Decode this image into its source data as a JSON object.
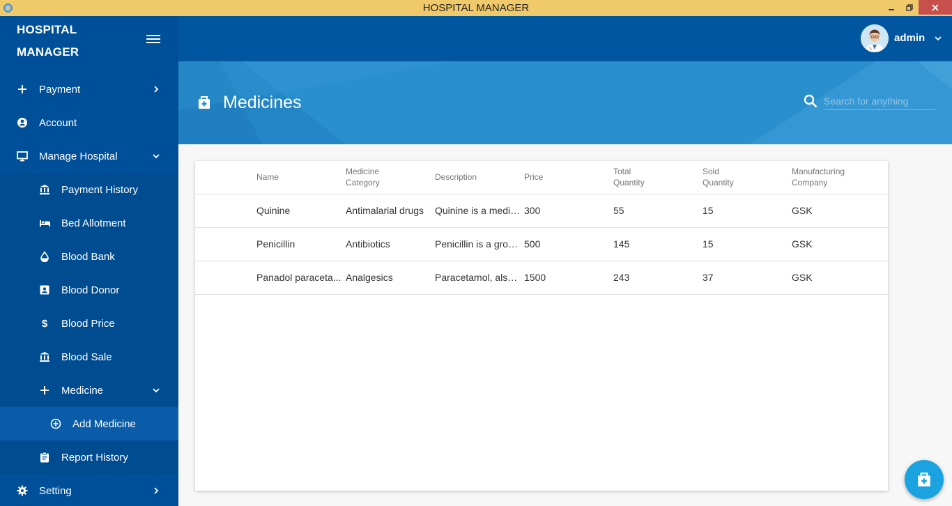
{
  "window": {
    "title": "HOSPITAL MANAGER"
  },
  "brand": {
    "line1": "HOSPITAL",
    "line2": "MANAGER"
  },
  "user": {
    "name": "admin"
  },
  "nav": {
    "payment": "Payment",
    "account": "Account",
    "manage_hospital": "Manage Hospital",
    "payment_history": "Payment History",
    "bed_allotment": "Bed Allotment",
    "blood_bank": "Blood Bank",
    "blood_donor": "Blood Donor",
    "blood_price": "Blood Price",
    "blood_sale": "Blood Sale",
    "medicine": "Medicine",
    "add_medicine": "Add Medicine",
    "report_history": "Report History",
    "setting": "Setting"
  },
  "page": {
    "title": "Medicines"
  },
  "search": {
    "placeholder": "Search for anything"
  },
  "table": {
    "headers": [
      {
        "l1": "Name",
        "l2": ""
      },
      {
        "l1": "Medicine",
        "l2": "Category"
      },
      {
        "l1": "Description",
        "l2": ""
      },
      {
        "l1": "Price",
        "l2": ""
      },
      {
        "l1": "Total",
        "l2": "Quantity"
      },
      {
        "l1": "Sold",
        "l2": "Quantity"
      },
      {
        "l1": "Manufacturing",
        "l2": "Company"
      }
    ],
    "rows": [
      [
        "Quinine",
        "Antimalarial drugs",
        "Quinine is a medic...",
        "300",
        "55",
        "15",
        "GSK"
      ],
      [
        "Penicillin",
        "Antibiotics",
        "Penicillin is a group...",
        "500",
        "145",
        "15",
        "GSK"
      ],
      [
        "Panadol paraceta...",
        "Analgesics",
        "Paracetamol, also ...",
        "1500",
        "243",
        "37",
        "GSK"
      ]
    ]
  },
  "colors": {
    "titlebar": "#f0c96b",
    "sidebar": "#005099",
    "topbar": "#00569f",
    "banner": "#2a8fcd",
    "fab": "#1aa3e0",
    "close": "#c7504c"
  },
  "icons": {
    "app": "gear-app-icon",
    "payment": "plus-icon",
    "account": "account-circle-icon",
    "manage": "monitor-icon",
    "bank": "bank-icon",
    "bed": "bed-icon",
    "drop": "drop-icon",
    "donor": "contact-card-icon",
    "dollar": "dollar-icon",
    "medicine": "plus-icon",
    "add": "plus-circle-icon",
    "report": "clipboard-icon",
    "setting": "gear-icon",
    "page": "medical-bag-icon",
    "search": "search-icon",
    "fab": "medical-bag-icon"
  }
}
